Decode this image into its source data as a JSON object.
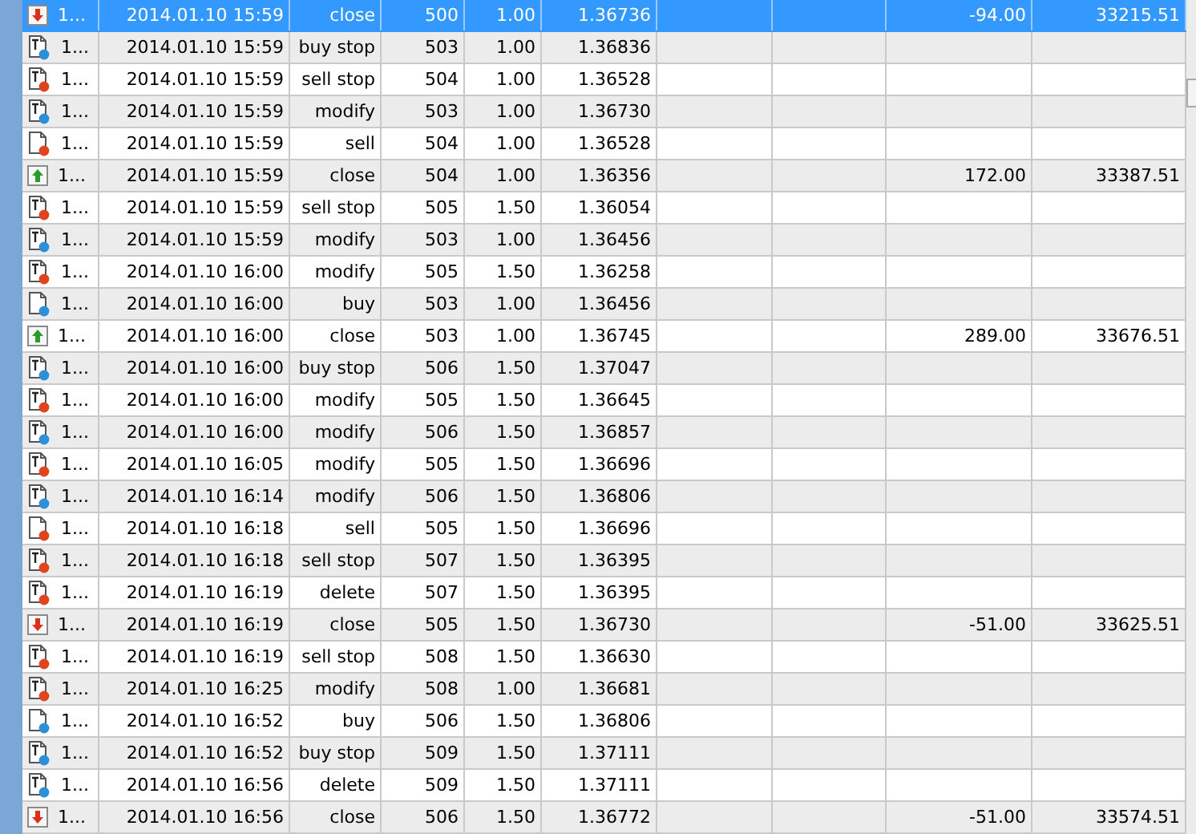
{
  "rows": [
    {
      "selected": true,
      "kind": "arrow_down",
      "ticket": "1...",
      "time": "2014.01.10 15:59",
      "type": "close",
      "order": "500",
      "size": "1.00",
      "price": "1.36736",
      "profit": "-94.00",
      "balance": "33215.51"
    },
    {
      "selected": false,
      "kind": "pending",
      "color": "#2e8fd8",
      "ticket": "1...",
      "time": "2014.01.10 15:59",
      "type": "buy stop",
      "order": "503",
      "size": "1.00",
      "price": "1.36836"
    },
    {
      "selected": false,
      "kind": "pending",
      "color": "#e0441c",
      "ticket": "1...",
      "time": "2014.01.10 15:59",
      "type": "sell stop",
      "order": "504",
      "size": "1.00",
      "price": "1.36528"
    },
    {
      "selected": false,
      "kind": "pending",
      "color": "#2e8fd8",
      "ticket": "1...",
      "time": "2014.01.10 15:59",
      "type": "modify",
      "order": "503",
      "size": "1.00",
      "price": "1.36730"
    },
    {
      "selected": false,
      "kind": "market",
      "color": "#e0441c",
      "ticket": "1...",
      "time": "2014.01.10 15:59",
      "type": "sell",
      "order": "504",
      "size": "1.00",
      "price": "1.36528"
    },
    {
      "selected": false,
      "kind": "arrow_up",
      "ticket": "1...",
      "time": "2014.01.10 15:59",
      "type": "close",
      "order": "504",
      "size": "1.00",
      "price": "1.36356",
      "profit": "172.00",
      "balance": "33387.51"
    },
    {
      "selected": false,
      "kind": "pending",
      "color": "#e0441c",
      "ticket": "1...",
      "time": "2014.01.10 15:59",
      "type": "sell stop",
      "order": "505",
      "size": "1.50",
      "price": "1.36054"
    },
    {
      "selected": false,
      "kind": "pending",
      "color": "#2e8fd8",
      "ticket": "1...",
      "time": "2014.01.10 15:59",
      "type": "modify",
      "order": "503",
      "size": "1.00",
      "price": "1.36456"
    },
    {
      "selected": false,
      "kind": "pending",
      "color": "#e0441c",
      "ticket": "1...",
      "time": "2014.01.10 16:00",
      "type": "modify",
      "order": "505",
      "size": "1.50",
      "price": "1.36258"
    },
    {
      "selected": false,
      "kind": "market",
      "color": "#2e8fd8",
      "ticket": "1...",
      "time": "2014.01.10 16:00",
      "type": "buy",
      "order": "503",
      "size": "1.00",
      "price": "1.36456"
    },
    {
      "selected": false,
      "kind": "arrow_up",
      "ticket": "1...",
      "time": "2014.01.10 16:00",
      "type": "close",
      "order": "503",
      "size": "1.00",
      "price": "1.36745",
      "profit": "289.00",
      "balance": "33676.51"
    },
    {
      "selected": false,
      "kind": "pending",
      "color": "#2e8fd8",
      "ticket": "1...",
      "time": "2014.01.10 16:00",
      "type": "buy stop",
      "order": "506",
      "size": "1.50",
      "price": "1.37047"
    },
    {
      "selected": false,
      "kind": "pending",
      "color": "#e0441c",
      "ticket": "1...",
      "time": "2014.01.10 16:00",
      "type": "modify",
      "order": "505",
      "size": "1.50",
      "price": "1.36645"
    },
    {
      "selected": false,
      "kind": "pending",
      "color": "#2e8fd8",
      "ticket": "1...",
      "time": "2014.01.10 16:00",
      "type": "modify",
      "order": "506",
      "size": "1.50",
      "price": "1.36857"
    },
    {
      "selected": false,
      "kind": "pending",
      "color": "#e0441c",
      "ticket": "1...",
      "time": "2014.01.10 16:05",
      "type": "modify",
      "order": "505",
      "size": "1.50",
      "price": "1.36696"
    },
    {
      "selected": false,
      "kind": "pending",
      "color": "#2e8fd8",
      "ticket": "1...",
      "time": "2014.01.10 16:14",
      "type": "modify",
      "order": "506",
      "size": "1.50",
      "price": "1.36806"
    },
    {
      "selected": false,
      "kind": "market",
      "color": "#e0441c",
      "ticket": "1...",
      "time": "2014.01.10 16:18",
      "type": "sell",
      "order": "505",
      "size": "1.50",
      "price": "1.36696"
    },
    {
      "selected": false,
      "kind": "pending",
      "color": "#e0441c",
      "ticket": "1...",
      "time": "2014.01.10 16:18",
      "type": "sell stop",
      "order": "507",
      "size": "1.50",
      "price": "1.36395"
    },
    {
      "selected": false,
      "kind": "pending",
      "color": "#e0441c",
      "ticket": "1...",
      "time": "2014.01.10 16:19",
      "type": "delete",
      "order": "507",
      "size": "1.50",
      "price": "1.36395"
    },
    {
      "selected": false,
      "kind": "arrow_down",
      "ticket": "1...",
      "time": "2014.01.10 16:19",
      "type": "close",
      "order": "505",
      "size": "1.50",
      "price": "1.36730",
      "profit": "-51.00",
      "balance": "33625.51"
    },
    {
      "selected": false,
      "kind": "pending",
      "color": "#e0441c",
      "ticket": "1...",
      "time": "2014.01.10 16:19",
      "type": "sell stop",
      "order": "508",
      "size": "1.50",
      "price": "1.36630"
    },
    {
      "selected": false,
      "kind": "pending",
      "color": "#e0441c",
      "ticket": "1...",
      "time": "2014.01.10 16:25",
      "type": "modify",
      "order": "508",
      "size": "1.00",
      "price": "1.36681"
    },
    {
      "selected": false,
      "kind": "market",
      "color": "#2e8fd8",
      "ticket": "1...",
      "time": "2014.01.10 16:52",
      "type": "buy",
      "order": "506",
      "size": "1.50",
      "price": "1.36806"
    },
    {
      "selected": false,
      "kind": "pending",
      "color": "#2e8fd8",
      "ticket": "1...",
      "time": "2014.01.10 16:52",
      "type": "buy stop",
      "order": "509",
      "size": "1.50",
      "price": "1.37111"
    },
    {
      "selected": false,
      "kind": "pending",
      "color": "#2e8fd8",
      "ticket": "1...",
      "time": "2014.01.10 16:56",
      "type": "delete",
      "order": "509",
      "size": "1.50",
      "price": "1.37111"
    },
    {
      "selected": false,
      "kind": "arrow_down",
      "ticket": "1...",
      "time": "2014.01.10 16:56",
      "type": "close",
      "order": "506",
      "size": "1.50",
      "price": "1.36772",
      "profit": "-51.00",
      "balance": "33574.51"
    }
  ]
}
